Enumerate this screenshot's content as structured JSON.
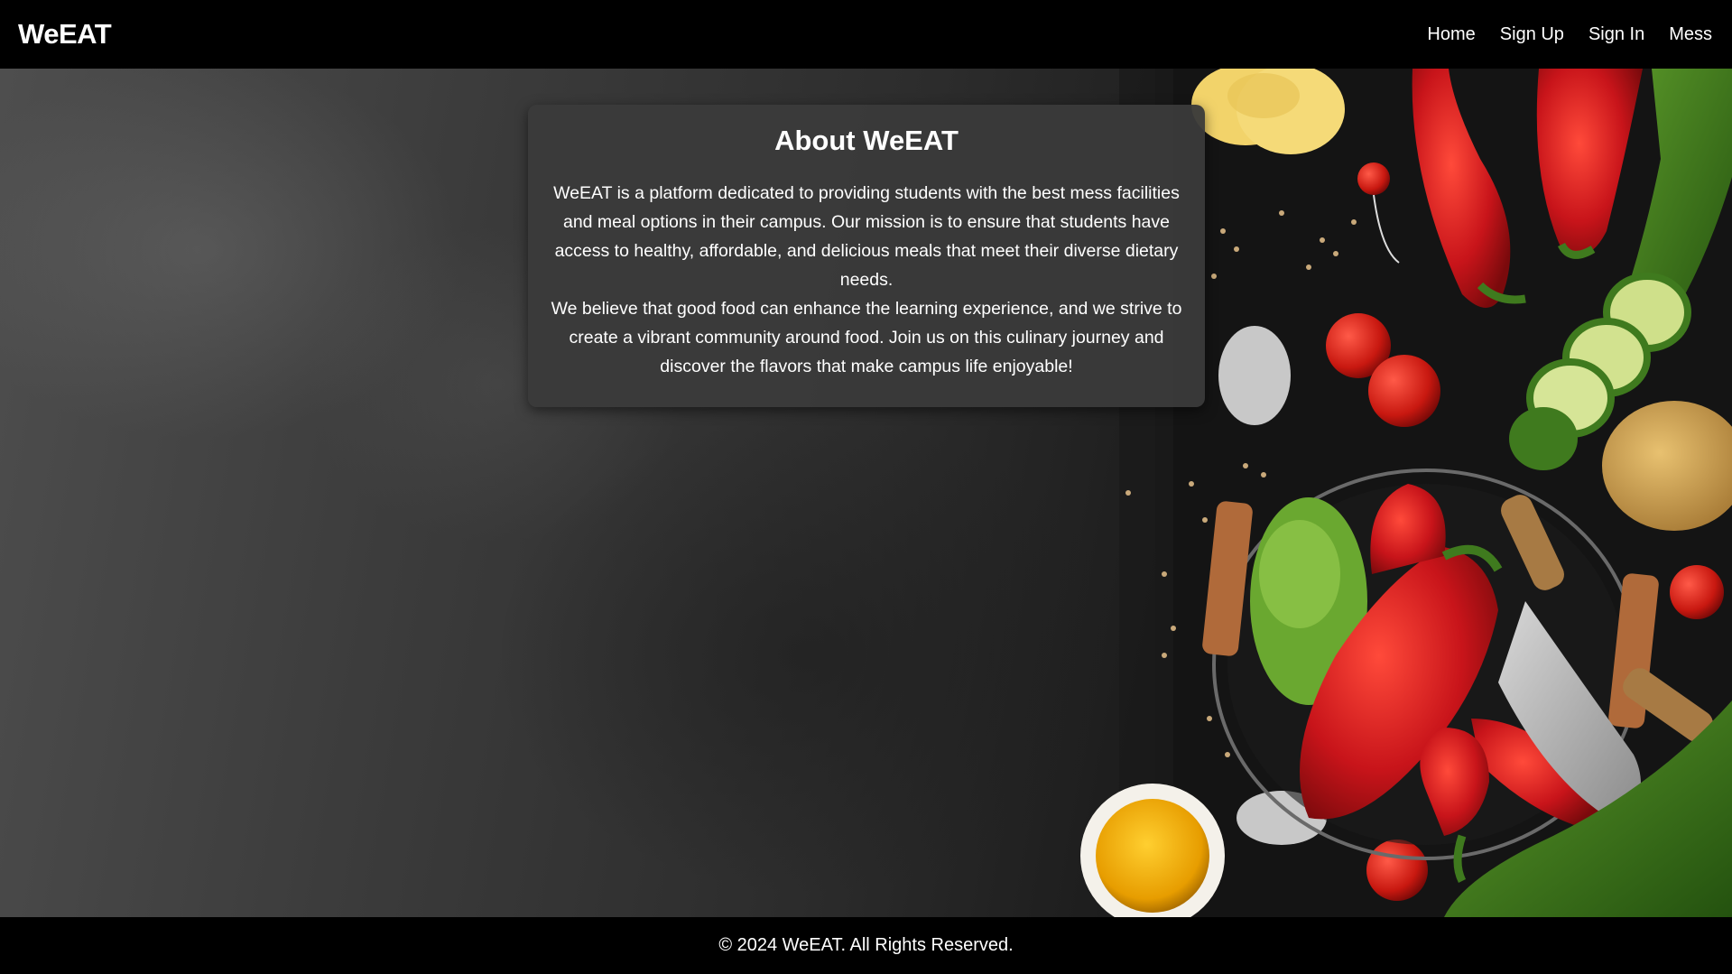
{
  "brand": {
    "name": "WeEAT"
  },
  "nav": {
    "items": [
      {
        "label": "Home"
      },
      {
        "label": "Sign Up"
      },
      {
        "label": "Sign In"
      },
      {
        "label": "Mess"
      }
    ]
  },
  "about": {
    "title": "About WeEAT",
    "paragraph1": "WeEAT is a platform dedicated to providing students with the best mess facilities and meal options in their campus. Our mission is to ensure that students have access to healthy, affordable, and delicious meals that meet their diverse dietary needs.",
    "paragraph2": "We believe that good food can enhance the learning experience, and we strive to create a vibrant community around food. Join us on this culinary journey and discover the flavors that make campus life enjoyable!"
  },
  "footer": {
    "text": "© 2024 WeEAT. All Rights Reserved."
  },
  "colors": {
    "navbar_bg": "#000000",
    "card_bg": "#3a3a3a",
    "text": "#ffffff",
    "pepper_red": "#c8141a",
    "zucchini_green": "#3f7a1e",
    "oil_yellow": "#f0a800"
  }
}
